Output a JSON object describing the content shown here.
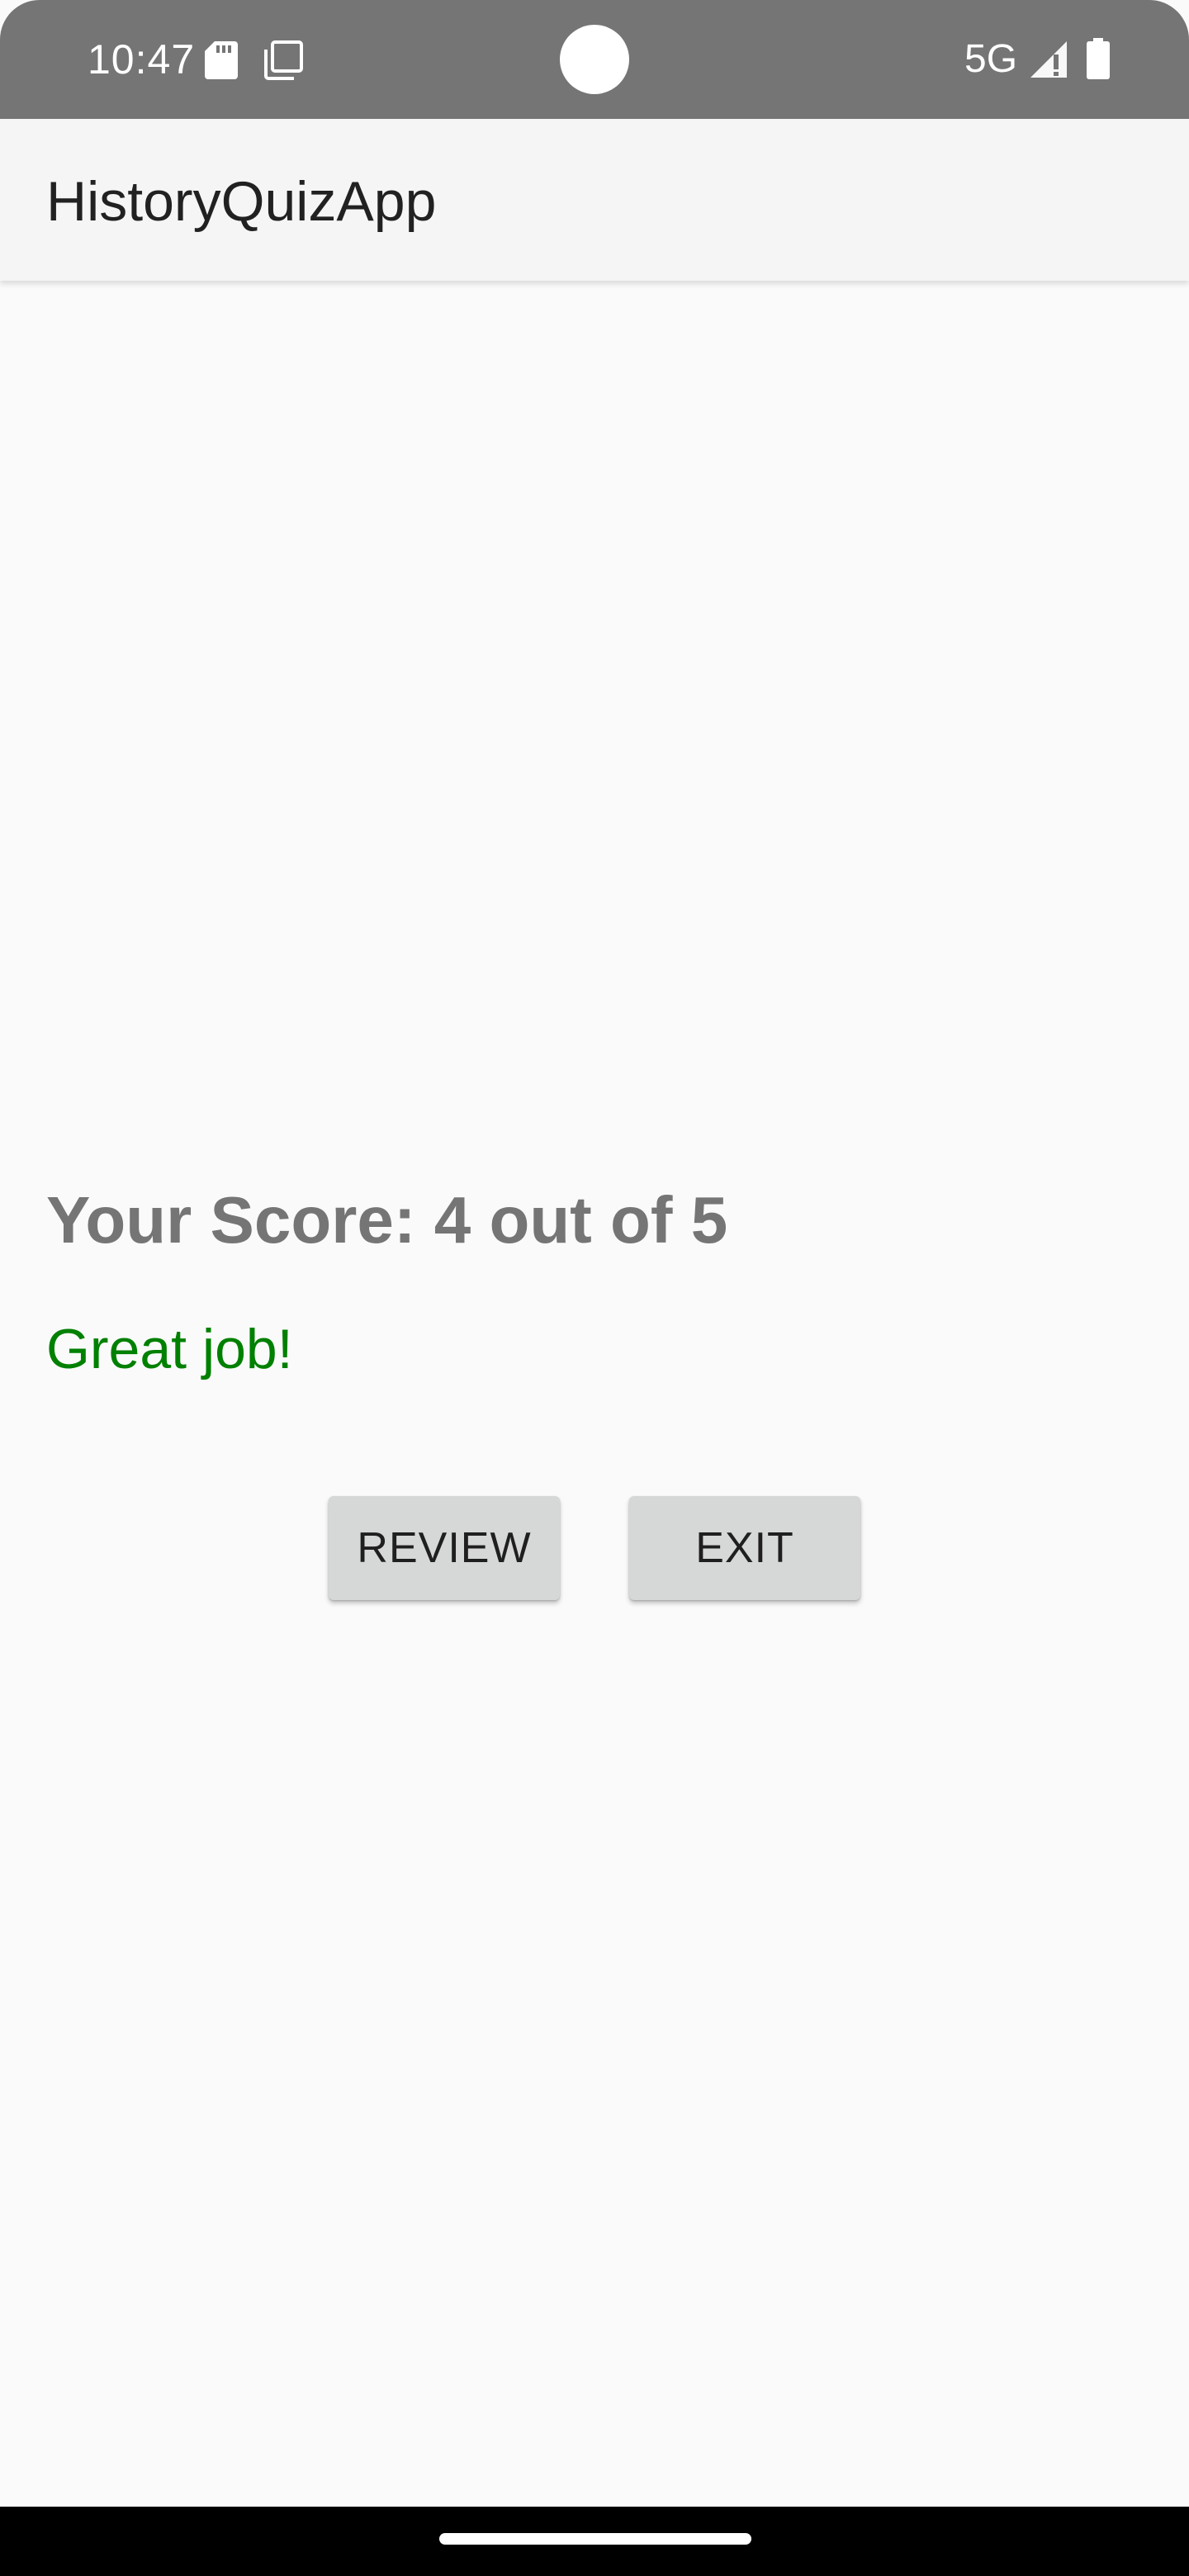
{
  "status_bar": {
    "time": "10:47",
    "network": "5G",
    "icons": [
      "sd-card-icon",
      "screenshot-icon",
      "signal-icon",
      "battery-icon"
    ]
  },
  "app_bar": {
    "title": "HistoryQuizApp"
  },
  "result": {
    "score_text": "Your Score: 4 out of 5",
    "feedback": "Great job!"
  },
  "actions": {
    "review_label": "REVIEW",
    "exit_label": "EXIT"
  },
  "colors": {
    "status_bar_bg": "#757575",
    "app_bar_bg": "#f5f5f5",
    "background": "#fafafa",
    "score_text": "#757575",
    "feedback_text": "#008000",
    "button_bg": "#d6d7d7",
    "nav_bar_bg": "#000000"
  }
}
